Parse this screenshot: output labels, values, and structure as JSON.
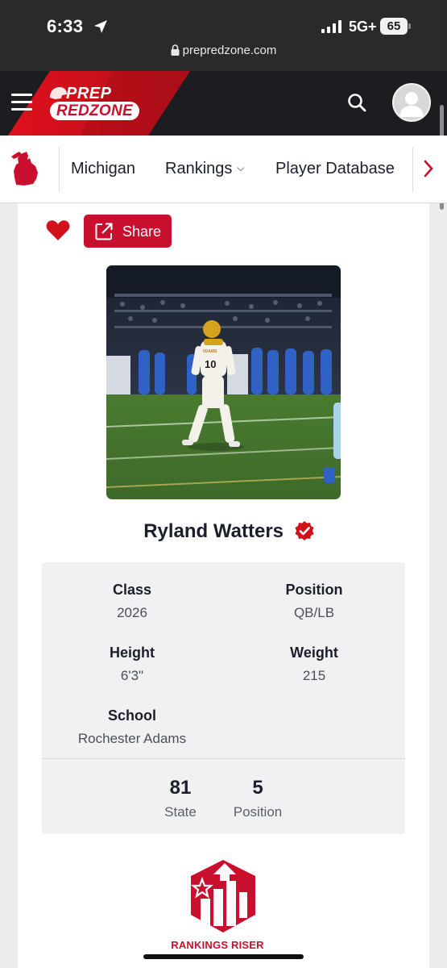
{
  "status_bar": {
    "time": "6:33",
    "network": "5G+",
    "battery": "65",
    "url": "prepredzone.com"
  },
  "header": {
    "logo_line1": "PREP",
    "logo_line2": "REDZONE",
    "brand_color": "#c8102e"
  },
  "nav": {
    "items": [
      {
        "label": "Michigan"
      },
      {
        "label": "Rankings"
      },
      {
        "label": "Player Database"
      }
    ]
  },
  "profile": {
    "share_label": "Share",
    "name": "Ryland Watters",
    "info": {
      "class_label": "Class",
      "class_value": "2026",
      "position_label": "Position",
      "position_value": "QB/LB",
      "height_label": "Height",
      "height_value": "6'3\"",
      "weight_label": "Weight",
      "weight_value": "215",
      "school_label": "School",
      "school_value": "Rochester Adams"
    },
    "ranks": [
      {
        "value": "81",
        "label": "State"
      },
      {
        "value": "5",
        "label": "Position"
      }
    ],
    "jersey_text": "ADAMS",
    "jersey_number": "10",
    "badge_label": "RANKINGS RISER"
  }
}
